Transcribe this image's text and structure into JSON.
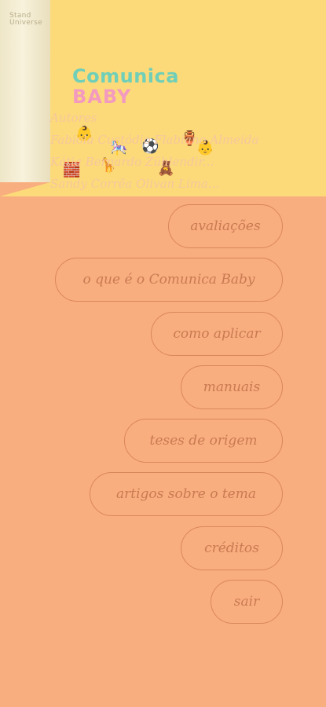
{
  "corner_text": [
    "Stand",
    "Universe"
  ],
  "logo": {
    "line1": "Comunica",
    "line2": "BABY"
  },
  "authors": {
    "heading": "Autores",
    "names": [
      "Fabiola Custódio Flabiano Almeida",
      "Kátia Bernardo Zühlendir...",
      "Sandy Corrêa Olivan Lima..."
    ]
  },
  "menu": [
    "avaliações",
    "o que é o Comunica Baby",
    "como aplicar",
    "manuais",
    "teses de origem",
    "artigos sobre o tema",
    "créditos",
    "sair"
  ],
  "colors": {
    "background": "#F9AE7F",
    "top_band": "#FCDA79",
    "button_border": "#D9875D",
    "button_text": "#C97A52"
  }
}
